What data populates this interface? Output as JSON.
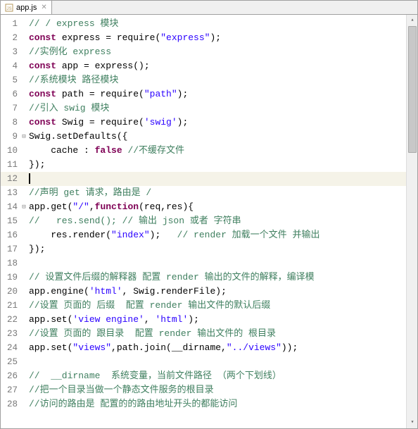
{
  "tab": {
    "filename": "app.js",
    "icon": "js-file-icon"
  },
  "code": {
    "lines": [
      {
        "num": 1,
        "fold": "",
        "segs": [
          [
            "cmt",
            "// / express 模块"
          ]
        ]
      },
      {
        "num": 2,
        "fold": "",
        "segs": [
          [
            "kw",
            "const"
          ],
          [
            "",
            " express = require("
          ],
          [
            "str",
            "\"express\""
          ],
          [
            "",
            ");"
          ]
        ]
      },
      {
        "num": 3,
        "fold": "",
        "segs": [
          [
            "cmt",
            "//实例化 express"
          ]
        ]
      },
      {
        "num": 4,
        "fold": "",
        "segs": [
          [
            "kw",
            "const"
          ],
          [
            "",
            " app = express();"
          ]
        ]
      },
      {
        "num": 5,
        "fold": "",
        "segs": [
          [
            "cmt",
            "//系统模块 路径模块"
          ]
        ]
      },
      {
        "num": 6,
        "fold": "",
        "segs": [
          [
            "kw",
            "const"
          ],
          [
            "",
            " path = require("
          ],
          [
            "str",
            "\"path\""
          ],
          [
            "",
            ");"
          ]
        ]
      },
      {
        "num": 7,
        "fold": "",
        "segs": [
          [
            "cmt",
            "//引入 swig 模块"
          ]
        ]
      },
      {
        "num": 8,
        "fold": "",
        "segs": [
          [
            "kw",
            "const"
          ],
          [
            "",
            " Swig = require("
          ],
          [
            "str",
            "'swig'"
          ],
          [
            "",
            ");"
          ]
        ]
      },
      {
        "num": 9,
        "fold": "⊟",
        "segs": [
          [
            "",
            "Swig.setDefaults({"
          ]
        ]
      },
      {
        "num": 10,
        "fold": "",
        "segs": [
          [
            "",
            "    cache : "
          ],
          [
            "kw",
            "false"
          ],
          [
            "",
            " "
          ],
          [
            "cmt",
            "//不缓存文件"
          ]
        ]
      },
      {
        "num": 11,
        "fold": "",
        "segs": [
          [
            "",
            "});"
          ]
        ]
      },
      {
        "num": 12,
        "fold": "",
        "current": true,
        "cursor": true,
        "segs": []
      },
      {
        "num": 13,
        "fold": "",
        "segs": [
          [
            "cmt",
            "//声明 get 请求，路由是 /"
          ]
        ]
      },
      {
        "num": 14,
        "fold": "⊟",
        "segs": [
          [
            "",
            "app.get("
          ],
          [
            "str",
            "\"/\""
          ],
          [
            "",
            ","
          ],
          [
            "kw",
            "function"
          ],
          [
            "",
            "(req,res){"
          ]
        ]
      },
      {
        "num": 15,
        "fold": "",
        "segs": [
          [
            "cmt",
            "//   res.send(); // 输出 json 或者 字符串"
          ]
        ]
      },
      {
        "num": 16,
        "fold": "",
        "segs": [
          [
            "",
            "    res.render("
          ],
          [
            "str",
            "\"index\""
          ],
          [
            "",
            ");   "
          ],
          [
            "cmt",
            "// render 加载一个文件 并输出"
          ]
        ]
      },
      {
        "num": 17,
        "fold": "",
        "segs": [
          [
            "",
            "});"
          ]
        ]
      },
      {
        "num": 18,
        "fold": "",
        "segs": []
      },
      {
        "num": 19,
        "fold": "",
        "segs": [
          [
            "cmt",
            "// 设置文件后缀的解释器 配置 render 输出的文件的解释，编译模"
          ]
        ]
      },
      {
        "num": 20,
        "fold": "",
        "segs": [
          [
            "",
            "app.engine("
          ],
          [
            "str",
            "'html'"
          ],
          [
            "",
            ", Swig.renderFile);"
          ]
        ]
      },
      {
        "num": 21,
        "fold": "",
        "segs": [
          [
            "cmt",
            "//设置 页面的 后缀  配置 render 输出文件的默认后缀"
          ]
        ]
      },
      {
        "num": 22,
        "fold": "",
        "segs": [
          [
            "",
            "app.set("
          ],
          [
            "str",
            "'view engine'"
          ],
          [
            "",
            ", "
          ],
          [
            "str",
            "'html'"
          ],
          [
            "",
            ");"
          ]
        ]
      },
      {
        "num": 23,
        "fold": "",
        "segs": [
          [
            "cmt",
            "//设置 页面的 跟目录  配置 render 输出文件的 根目录"
          ]
        ]
      },
      {
        "num": 24,
        "fold": "",
        "segs": [
          [
            "",
            "app.set("
          ],
          [
            "str",
            "\"views\""
          ],
          [
            "",
            ",path.join(__dirname,"
          ],
          [
            "str",
            "\"../views\""
          ],
          [
            "",
            "));"
          ]
        ]
      },
      {
        "num": 25,
        "fold": "",
        "segs": []
      },
      {
        "num": 26,
        "fold": "",
        "segs": [
          [
            "cmt",
            "//  __dirname  系统变量，当前文件路径 （两个下划线）"
          ]
        ]
      },
      {
        "num": 27,
        "fold": "",
        "segs": [
          [
            "cmt",
            "//把一个目录当做一个静态文件服务的根目录"
          ]
        ]
      },
      {
        "num": 28,
        "fold": "",
        "segs": [
          [
            "cmt",
            "//访问的路由是 配置的的路由地址开头的都能访问"
          ]
        ]
      }
    ]
  }
}
